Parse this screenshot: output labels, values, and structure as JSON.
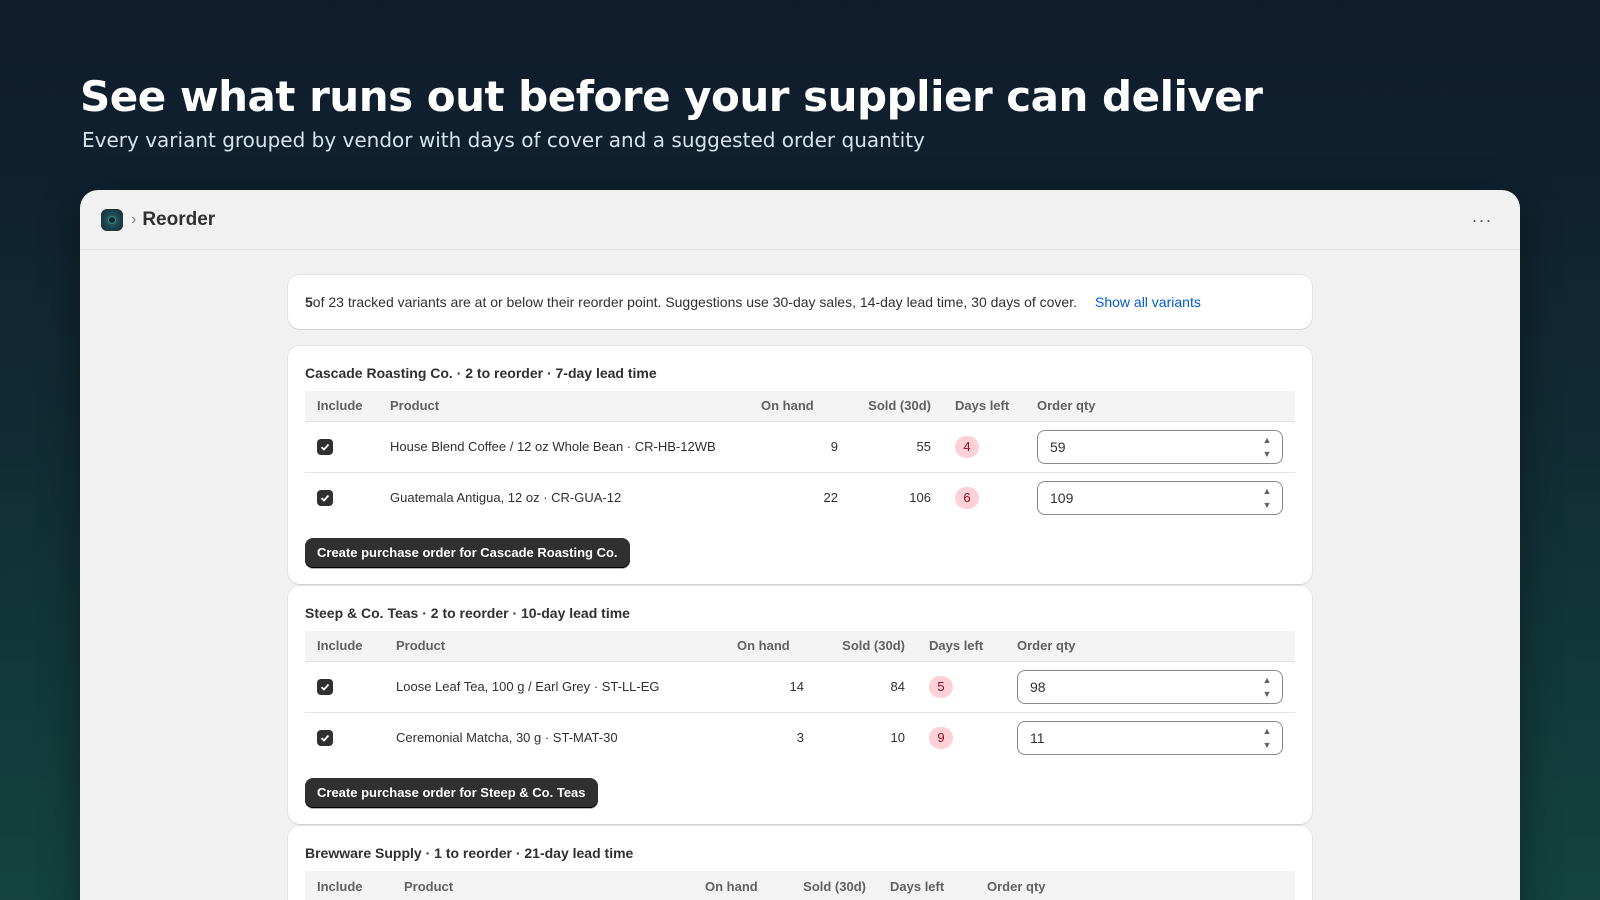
{
  "hero": {
    "title": "See what runs out before your supplier can deliver",
    "subtitle": "Every variant grouped by vendor with days of cover and a suggested order quantity"
  },
  "app": {
    "icon": "app-logo-icon",
    "page_title": "Reorder",
    "more_actions": "···"
  },
  "banner": {
    "count": "5",
    "text": " of 23 tracked variants are at or below their reorder point. Suggestions use 30-day sales, 14-day lead time, 30 days of cover.",
    "link": "Show all variants"
  },
  "columns": {
    "include": "Include",
    "product": "Product",
    "on_hand": "On hand",
    "sold": "Sold (30d)",
    "days_left": "Days left",
    "order_qty": "Order qty"
  },
  "vendors": [
    {
      "heading": "Cascade Roasting Co. · 2 to reorder · 7-day lead time",
      "button": "Create purchase order for Cascade Roasting Co.",
      "rows": [
        {
          "product": "House Blend Coffee / 12 oz Whole Bean · CR-HB-12WB",
          "on_hand": "9",
          "sold": "55",
          "days_left": "4",
          "order_qty": "59",
          "included": true
        },
        {
          "product": "Guatemala Antigua, 12 oz · CR-GUA-12",
          "on_hand": "22",
          "sold": "106",
          "days_left": "6",
          "order_qty": "109",
          "included": true
        }
      ]
    },
    {
      "heading": "Steep & Co. Teas · 2 to reorder · 10-day lead time",
      "button": "Create purchase order for Steep & Co. Teas",
      "rows": [
        {
          "product": "Loose Leaf Tea, 100 g / Earl Grey · ST-LL-EG",
          "on_hand": "14",
          "sold": "84",
          "days_left": "5",
          "order_qty": "98",
          "included": true
        },
        {
          "product": "Ceremonial Matcha, 30 g · ST-MAT-30",
          "on_hand": "3",
          "sold": "10",
          "days_left": "9",
          "order_qty": "11",
          "included": true
        }
      ]
    },
    {
      "heading": "Brewware Supply · 1 to reorder · 21-day lead time",
      "rows": []
    }
  ],
  "colors": {
    "badge_bg": "#fed1d7",
    "badge_text": "#8e0b21",
    "primary_button": "#303030",
    "link": "#005bd3"
  }
}
